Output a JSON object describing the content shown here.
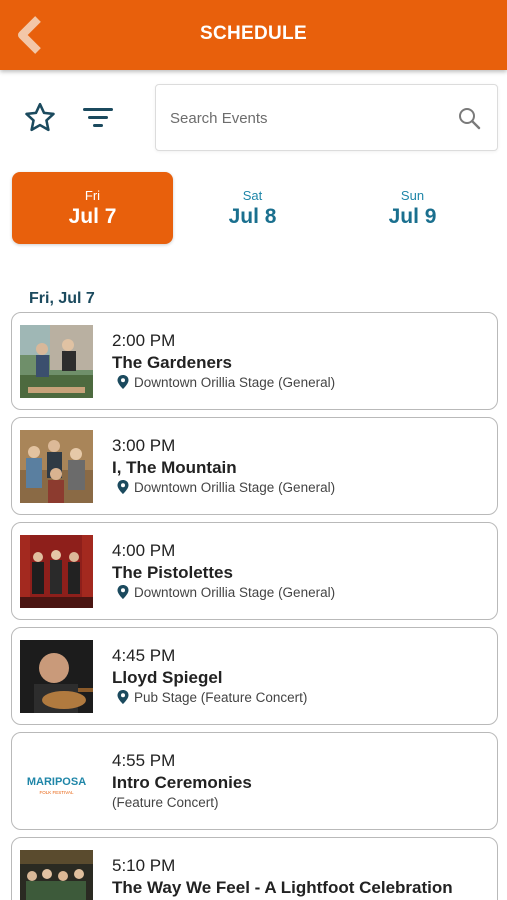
{
  "header": {
    "title": "SCHEDULE",
    "back_icon": "chevron-left-icon"
  },
  "toolbar": {
    "favorite_icon": "star-outline-icon",
    "filter_icon": "filter-icon",
    "search_placeholder": "Search Events",
    "search_icon": "search-icon"
  },
  "day_tabs": [
    {
      "dow": "Fri",
      "date": "Jul 7",
      "active": true
    },
    {
      "dow": "Sat",
      "date": "Jul 8",
      "active": false
    },
    {
      "dow": "Sun",
      "date": "Jul 9",
      "active": false
    }
  ],
  "section_heading": "Fri, Jul 7",
  "events": [
    {
      "time": "2:00 PM",
      "name": "The Gardeners",
      "venue": "Downtown Orillia Stage (General)",
      "has_pin": true
    },
    {
      "time": "3:00 PM",
      "name": "I, The Mountain",
      "venue": "Downtown Orillia Stage (General)",
      "has_pin": true
    },
    {
      "time": "4:00 PM",
      "name": "The Pistolettes",
      "venue": "Downtown Orillia Stage (General)",
      "has_pin": true
    },
    {
      "time": "4:45 PM",
      "name": "Lloyd Spiegel",
      "venue": "Pub Stage (Feature Concert)",
      "has_pin": true
    },
    {
      "time": "4:55 PM",
      "name": "Intro Ceremonies",
      "venue": "(Feature Concert)",
      "has_pin": false,
      "logo_text": "MARIPOSA",
      "logo_subtext": "FOLK FESTIVAL"
    },
    {
      "time": "5:10 PM",
      "name": "The Way We Feel - A Lightfoot Celebration",
      "venue": "",
      "has_pin": false
    }
  ],
  "colors": {
    "accent": "#e8600c",
    "tab_inactive": "#1a6f8e",
    "heading": "#1b4a5e"
  }
}
